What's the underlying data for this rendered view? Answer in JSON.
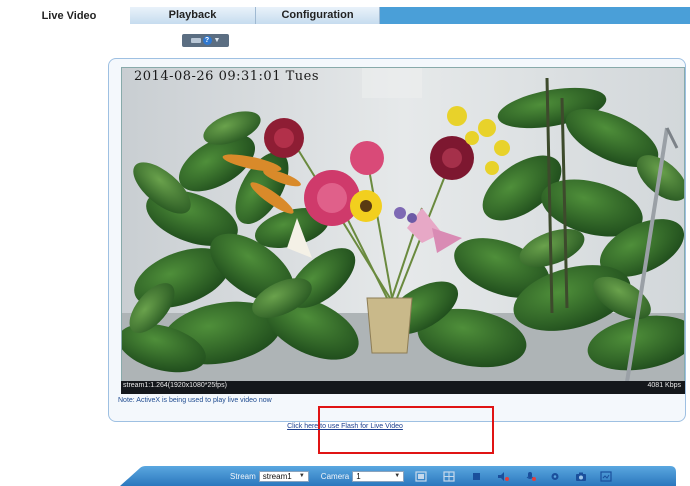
{
  "tabs": [
    {
      "label": "Live Video",
      "active": true
    },
    {
      "label": "Playback",
      "active": false
    },
    {
      "label": "Configuration",
      "active": false
    }
  ],
  "view_selector": {
    "icon": "view-mode-icon",
    "help_icon": "help-icon"
  },
  "video": {
    "timestamp": "2014-08-26 09:31:01 Tues",
    "stream_info": "stream1:1.264(1920x1080*25fps)",
    "bitrate": "4081 Kbps"
  },
  "note": "Note: ActiveX is being used to play live video now",
  "flash_link": "Click here to use Flash for Live Video",
  "toolbar": {
    "stream_label": "Stream",
    "stream_value": "stream1",
    "camera_label": "Camera",
    "camera_value": "1",
    "icons": [
      "single-view-icon",
      "multi-view-icon",
      "stop-icon",
      "audio-icon",
      "microphone-icon",
      "settings-icon",
      "snapshot-icon",
      "record-icon"
    ]
  },
  "colors": {
    "tab_strip": "#4a9fd8",
    "link": "#1d3f8f",
    "highlight_box": "#e01414",
    "toolbar": "#3c8fd0"
  }
}
